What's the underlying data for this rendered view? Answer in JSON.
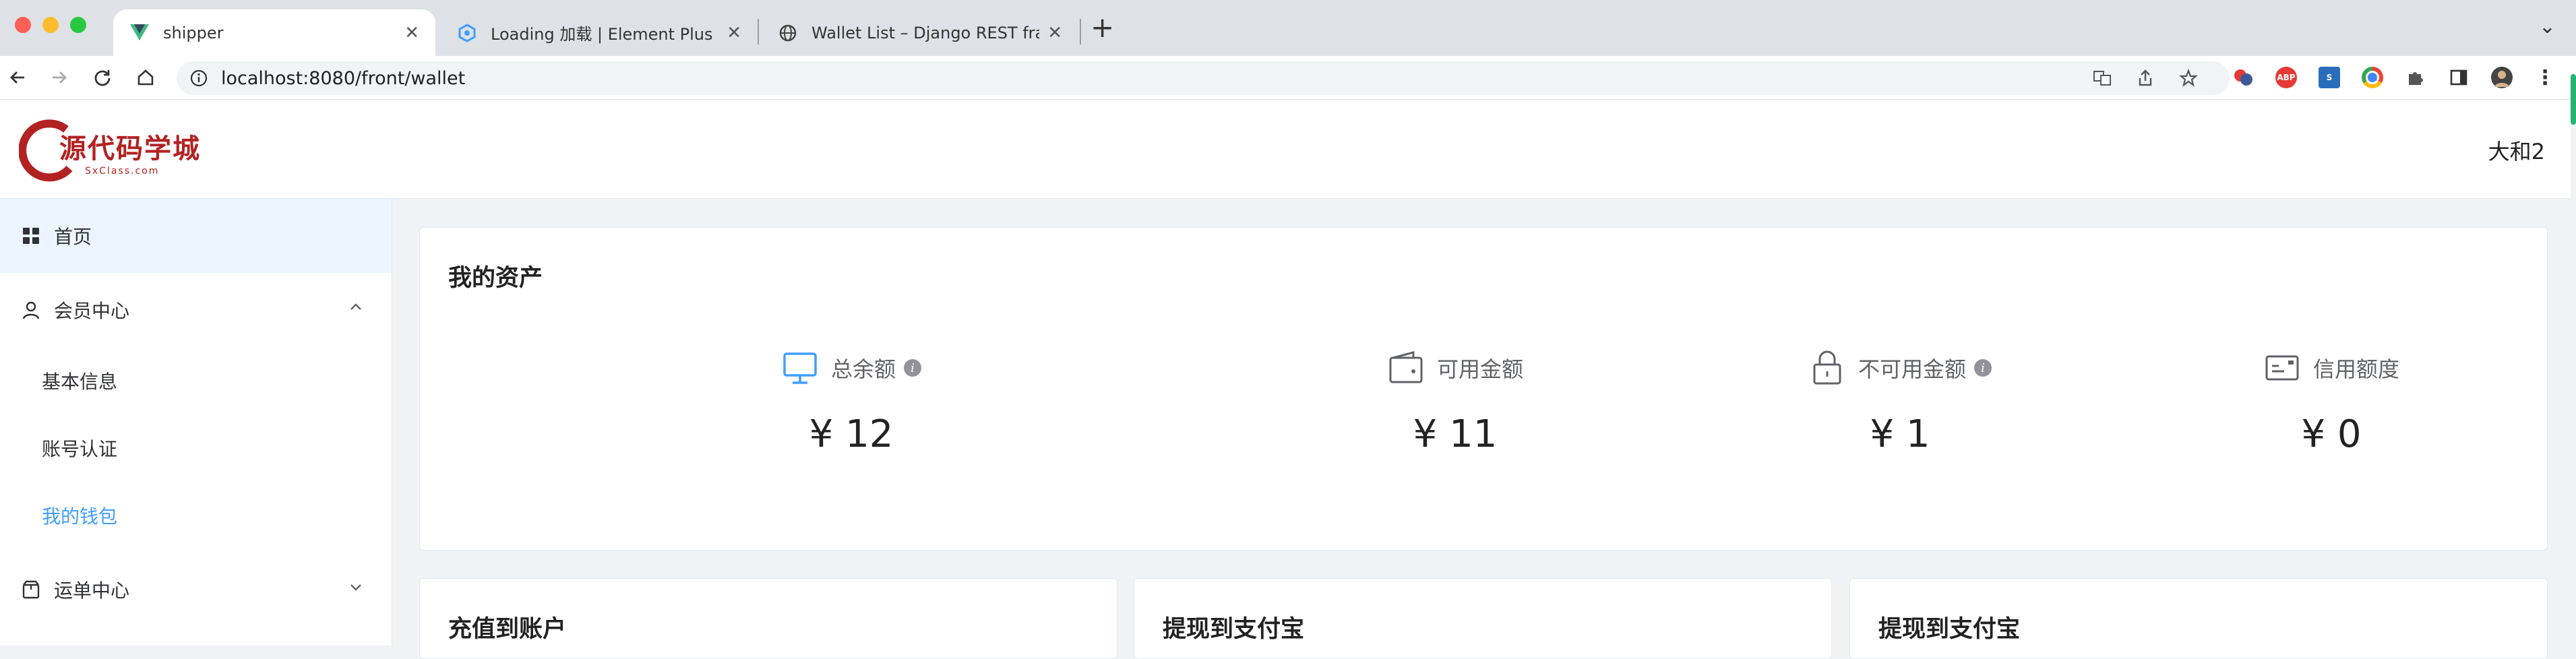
{
  "browser": {
    "tabs": [
      {
        "title": "shipper",
        "icon": "vue-icon",
        "active": true
      },
      {
        "title": "Loading 加载 | Element Plus",
        "icon": "element-plus-icon",
        "active": false
      },
      {
        "title": "Wallet List – Django REST fram",
        "icon": "globe-icon",
        "active": false
      }
    ],
    "url": "localhost:8080/front/wallet",
    "extensions": [
      "translate-icon",
      "share-icon",
      "bookmark-star-icon",
      "ext-red-icon",
      "adblock-plus-icon",
      "ext-blue-icon",
      "ext-circle-icon",
      "puzzle-icon",
      "sidebar-icon",
      "profile-avatar"
    ]
  },
  "header": {
    "logo_text": "源代码学城",
    "logo_sub": "SxClass.com",
    "user_name": "大和2"
  },
  "sidebar": {
    "home": "首页",
    "member_center": "会员中心",
    "member_items": [
      "基本信息",
      "账号认证",
      "我的钱包"
    ],
    "active_item": "我的钱包",
    "waybill_center": "运单中心"
  },
  "assets": {
    "title": "我的资产",
    "stats": [
      {
        "label": "总余额",
        "value": "¥ 12",
        "icon": "monitor-icon",
        "has_info": true
      },
      {
        "label": "可用金额",
        "value": "¥ 11",
        "icon": "wallet-icon",
        "has_info": false
      },
      {
        "label": "不可用金额",
        "value": "¥ 1",
        "icon": "lock-icon",
        "has_info": true
      },
      {
        "label": "信用额度",
        "value": "¥ 0",
        "icon": "credit-card-icon",
        "has_info": false
      }
    ]
  },
  "cards": {
    "recharge_title": "充值到账户",
    "withdraw_title_1": "提现到支付宝",
    "withdraw_title_2": "提现到支付宝"
  },
  "colors": {
    "accent": "#409eff",
    "home_bg": "#ecf5ff",
    "logo_red": "#b22222"
  }
}
